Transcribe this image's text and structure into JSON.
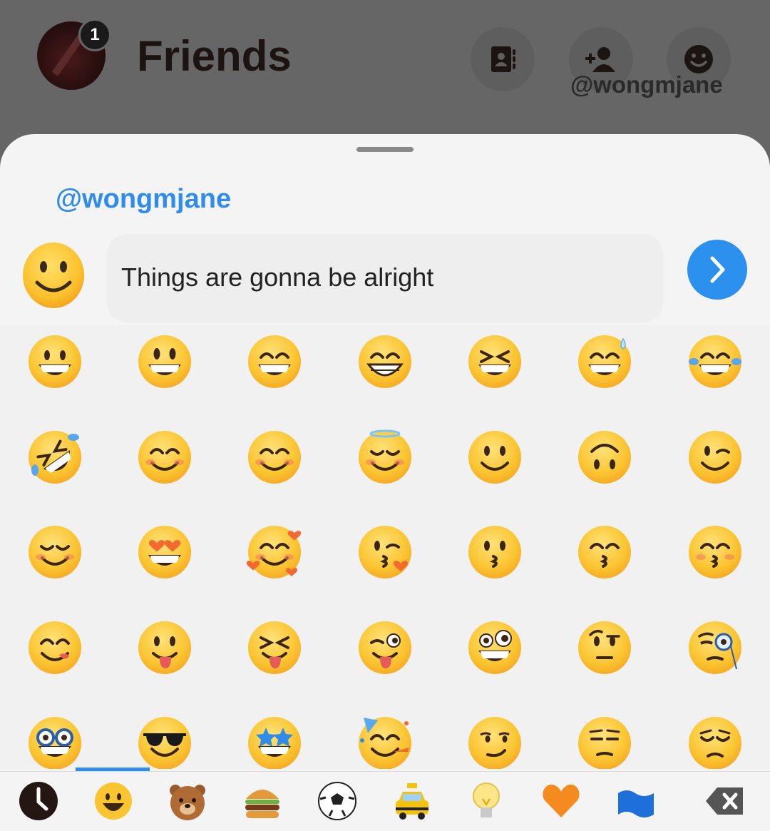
{
  "header": {
    "title": "Friends",
    "notification_count": "1",
    "watermark": "@wongmjane",
    "buttons": [
      {
        "icon": "contacts-book-icon"
      },
      {
        "icon": "add-friend-icon"
      },
      {
        "icon": "bitmoji-face-icon"
      }
    ]
  },
  "composer": {
    "mention": "@wongmjane",
    "message": "Things are gonna be alright",
    "send_icon": "chevron-right-icon"
  },
  "emoji_grid": {
    "rows": [
      [
        "grinning-face",
        "grinning-face-big-eyes",
        "grinning-face-smiling-eyes",
        "beaming-face",
        "grinning-squinting-face",
        "grinning-face-sweat",
        "tears-of-joy"
      ],
      [
        "rolling-on-floor-laughing",
        "smiling-face",
        "smiling-face-smiling-eyes",
        "smiling-face-halo",
        "slightly-smiling-face",
        "upside-down-face",
        "winking-face"
      ],
      [
        "relieved-face",
        "heart-eyes-face",
        "smiling-face-hearts",
        "face-blowing-kiss",
        "kissing-face",
        "kissing-face-smiling-eyes",
        "kissing-face-closed-eyes"
      ],
      [
        "face-savoring-food",
        "face-with-tongue",
        "squinting-face-tongue",
        "winking-face-tongue",
        "zany-face",
        "face-raised-eyebrow",
        "face-with-monocle"
      ],
      [
        "nerd-face",
        "smiling-face-sunglasses",
        "star-struck",
        "partying-face",
        "smirking-face",
        "unamused-face",
        "pensive-face"
      ]
    ]
  },
  "categories": [
    {
      "icon": "recent-clock-icon",
      "selected": true
    },
    {
      "icon": "smileys-icon"
    },
    {
      "icon": "animals-bear-icon"
    },
    {
      "icon": "food-burger-icon"
    },
    {
      "icon": "activity-soccer-icon"
    },
    {
      "icon": "travel-taxi-icon"
    },
    {
      "icon": "objects-lightbulb-icon"
    },
    {
      "icon": "symbols-heart-icon"
    },
    {
      "icon": "flags-icon"
    },
    {
      "icon": "backspace-icon"
    }
  ],
  "colors": {
    "accent": "#2f8cea",
    "overlay": "#666666",
    "sheet": "#f4f4f4",
    "emoji_yellow": "#fbc531",
    "emoji_orange": "#f6a623"
  }
}
